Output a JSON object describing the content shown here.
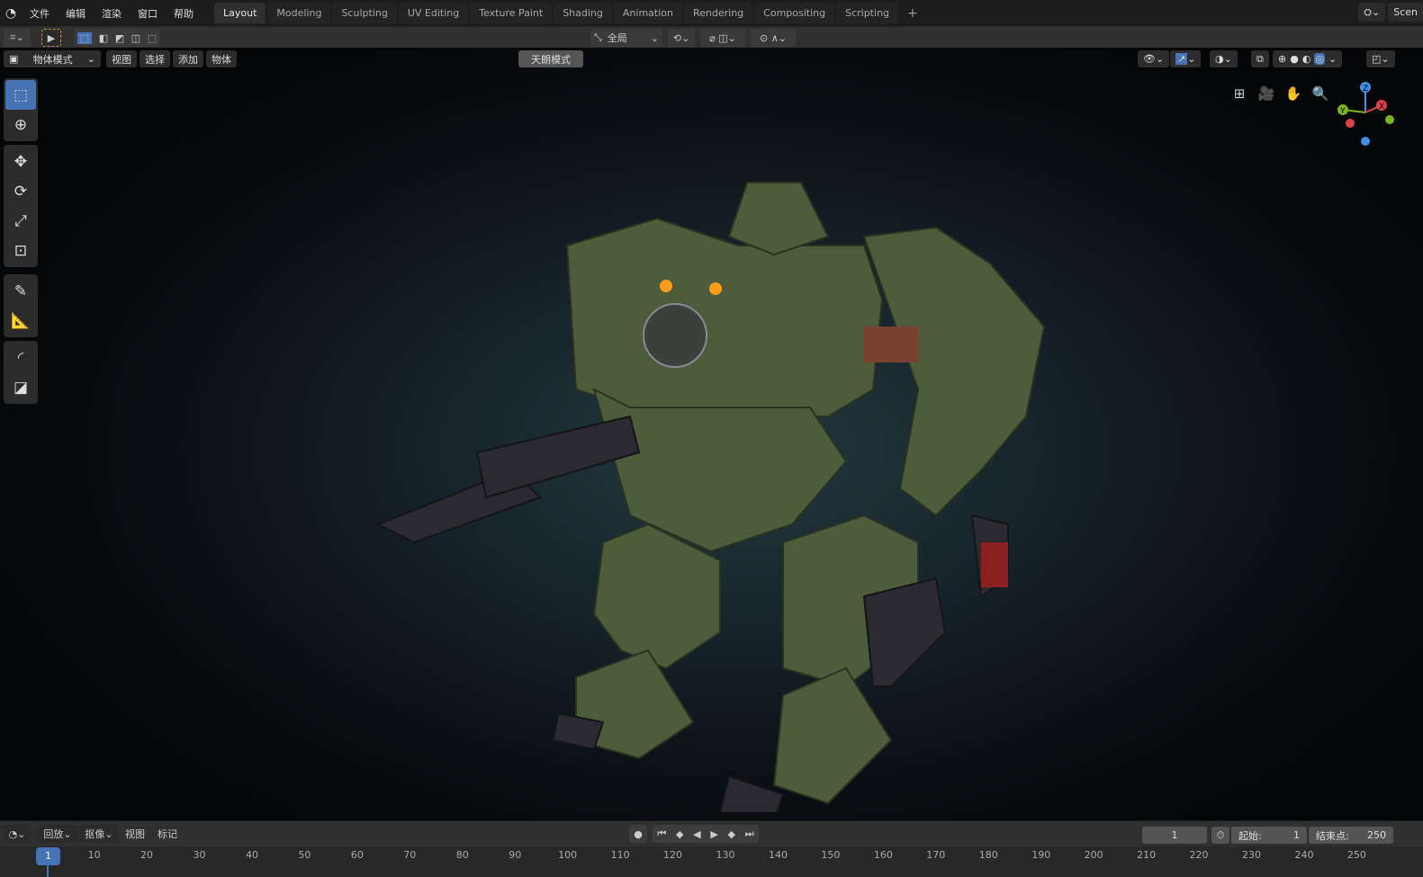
{
  "topbar": {
    "menus": [
      "文件",
      "编辑",
      "渲染",
      "窗口",
      "帮助"
    ],
    "tabs": [
      "Layout",
      "Modeling",
      "Sculpting",
      "UV Editing",
      "Texture Paint",
      "Shading",
      "Animation",
      "Rendering",
      "Compositing",
      "Scripting"
    ],
    "active_tab": "Layout",
    "scene": "Scen"
  },
  "toolhdr": {
    "orientation": "全局"
  },
  "viewport_header": {
    "mode": "物体模式",
    "menus": [
      "视图",
      "选择",
      "添加",
      "物体"
    ],
    "notice": "天朗模式"
  },
  "timeline": {
    "menus": [
      "回放",
      "抠像",
      "视图",
      "标记"
    ],
    "current_frame": "1",
    "start_label": "起始:",
    "start": "1",
    "end_label": "结束点:",
    "end": "250",
    "frame_marker": "1",
    "ticks": [
      "10",
      "20",
      "30",
      "40",
      "50",
      "60",
      "70",
      "80",
      "90",
      "100",
      "110",
      "120",
      "130",
      "140",
      "150",
      "160",
      "170",
      "180",
      "190",
      "200",
      "210",
      "220",
      "230",
      "240",
      "250"
    ]
  },
  "colors": {
    "accent": "#4772b3",
    "axis_x": "#e0404a",
    "axis_y": "#7ab51d",
    "axis_z": "#3d8fe8"
  }
}
